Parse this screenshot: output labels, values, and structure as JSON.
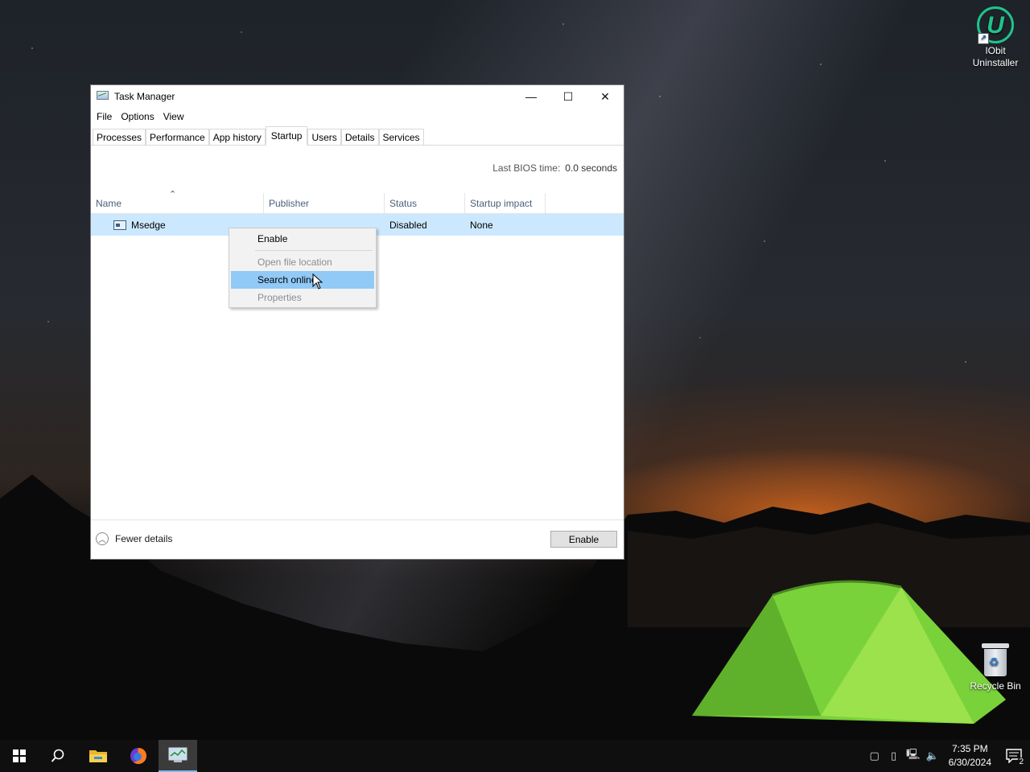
{
  "desktop": {
    "icons": [
      {
        "label": "IObit Uninstaller"
      },
      {
        "label": "Recycle Bin"
      }
    ]
  },
  "window": {
    "title": "Task Manager",
    "controls": {
      "minimize": "—",
      "maximize": "☐",
      "close": "✕"
    },
    "menu": [
      "File",
      "Options",
      "View"
    ],
    "tabs": [
      "Processes",
      "Performance",
      "App history",
      "Startup",
      "Users",
      "Details",
      "Services"
    ],
    "active_tab": "Startup",
    "bios_label": "Last BIOS time:",
    "bios_value": "0.0 seconds",
    "columns": [
      "Name",
      "Publisher",
      "Status",
      "Startup impact"
    ],
    "rows": [
      {
        "name": "Msedge",
        "publisher": "",
        "status": "Disabled",
        "impact": "None"
      }
    ],
    "footer": {
      "fewer_details": "Fewer details",
      "enable_button": "Enable"
    }
  },
  "context_menu": {
    "items": [
      {
        "label": "Enable",
        "disabled": false
      },
      {
        "label": "Open file location",
        "disabled": true
      },
      {
        "label": "Search online",
        "disabled": false,
        "highlighted": true
      },
      {
        "label": "Properties",
        "disabled": true
      }
    ]
  },
  "taskbar": {
    "pinned": [
      "start-icon",
      "search-icon",
      "file-explorer-icon",
      "firefox-icon",
      "task-manager-icon"
    ],
    "clock_time": "7:35 PM",
    "clock_date": "6/30/2024",
    "notification_count": "2"
  },
  "colors": {
    "selection": "#cce8ff",
    "menu_highlight": "#91c9f7",
    "taskbar_active_underline": "#7db7e8"
  }
}
